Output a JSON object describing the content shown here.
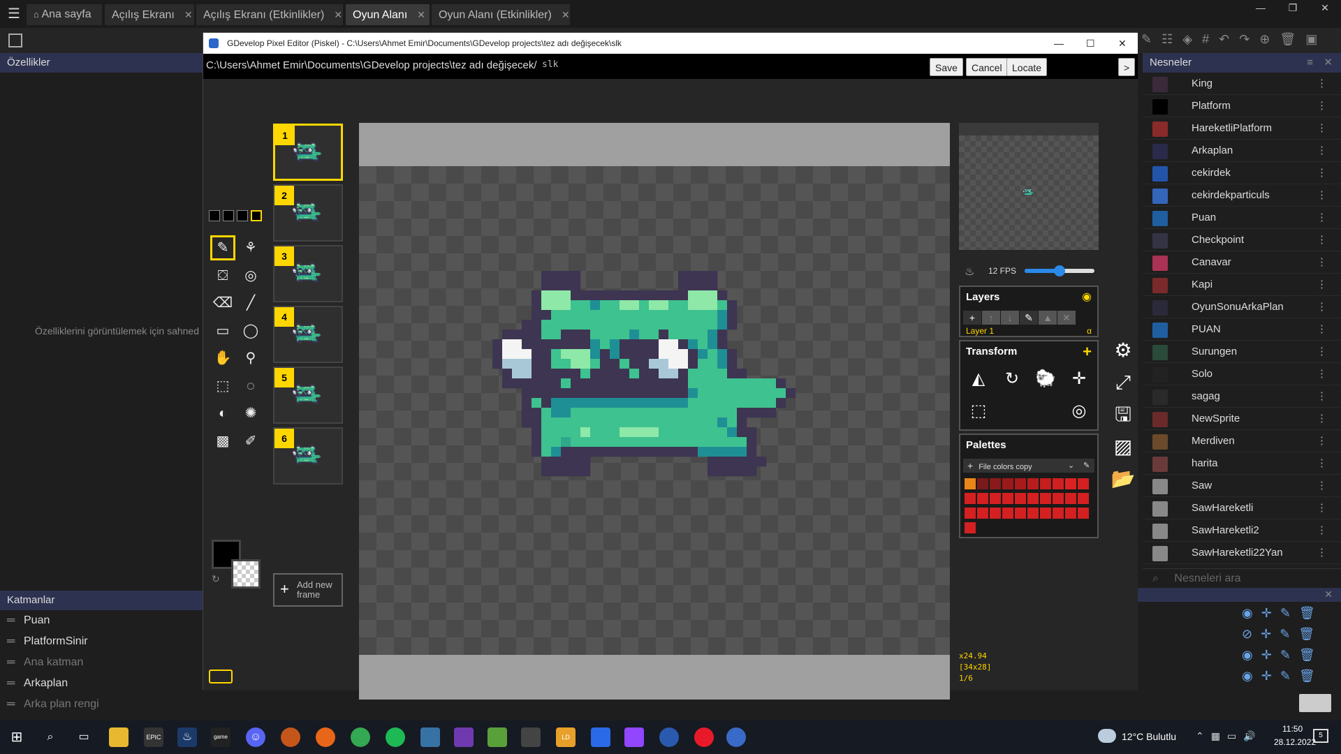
{
  "tabs": [
    {
      "label": "Ana sayfa",
      "active": false,
      "closable": false
    },
    {
      "label": "Açılış Ekranı",
      "active": false,
      "closable": true
    },
    {
      "label": "Açılış Ekranı (Etkinlikler)",
      "active": false,
      "closable": true
    },
    {
      "label": "Oyun Alanı",
      "active": true,
      "closable": true
    },
    {
      "label": "Oyun Alanı (Etkinlikler)",
      "active": false,
      "closable": true
    }
  ],
  "left_panel": {
    "title": "Özellikler",
    "empty_text": "Özelliklerini görüntülemek için sahned",
    "layers_title": "Katmanlar",
    "layers": [
      {
        "name": "Puan",
        "dim": false
      },
      {
        "name": "PlatformSinir",
        "dim": false
      },
      {
        "name": "Ana katman",
        "dim": true
      },
      {
        "name": "Arkaplan",
        "dim": false
      },
      {
        "name": "Arka plan rengi",
        "dim": true
      }
    ]
  },
  "right_panel": {
    "title": "Nesneler",
    "search_placeholder": "Nesneleri ara",
    "objects": [
      {
        "name": "King",
        "color": "#3a2a3a"
      },
      {
        "name": "Platform",
        "color": "#000000"
      },
      {
        "name": "HareketliPlatform",
        "color": "#8a2a2a"
      },
      {
        "name": "Arkaplan",
        "color": "#2a2a4a"
      },
      {
        "name": "cekirdek",
        "color": "#2255aa"
      },
      {
        "name": "cekirdekparticuls",
        "color": "#3366bb"
      },
      {
        "name": "Puan",
        "color": "#1f5f9f"
      },
      {
        "name": "Checkpoint",
        "color": "#333344"
      },
      {
        "name": "Canavar",
        "color": "#aa3355"
      },
      {
        "name": "Kapi",
        "color": "#7a2a2a"
      },
      {
        "name": "OyunSonuArkaPlan",
        "color": "#2a2a3a"
      },
      {
        "name": "PUAN",
        "color": "#1f5f9f"
      },
      {
        "name": "Surungen",
        "color": "#2a4a3a"
      },
      {
        "name": "Solo",
        "color": "#222222"
      },
      {
        "name": "sagag",
        "color": "#2a2a2a"
      },
      {
        "name": "NewSprite",
        "color": "#6a2a2a"
      },
      {
        "name": "Merdiven",
        "color": "#6a4a2a"
      },
      {
        "name": "harita",
        "color": "#6a3a3a"
      },
      {
        "name": "Saw",
        "color": "#888888"
      },
      {
        "name": "SawHareketli",
        "color": "#888888"
      },
      {
        "name": "SawHareketli2",
        "color": "#888888"
      },
      {
        "name": "SawHareketli22Yan",
        "color": "#888888"
      }
    ]
  },
  "piskel": {
    "window_title": "GDevelop Pixel Editor (Piskel) - C:\\Users\\Ahmet Emir\\Documents\\GDevelop projects\\tez adı değişecek\\slk",
    "path": "C:\\Users\\Ahmet Emir\\Documents\\GDevelop projects\\tez adı değişecek/",
    "file_name": "slk",
    "buttons": {
      "save": "Save",
      "cancel": "Cancel",
      "locate": "Locate",
      "more": ">"
    },
    "frames": [
      "1",
      "2",
      "3",
      "4",
      "5",
      "6"
    ],
    "add_frame_label": "Add new frame",
    "fps_label": "12 FPS",
    "fps_value": 12,
    "layers_title": "Layers",
    "layer_name": "Layer 1",
    "layer_alpha": "α",
    "transform_title": "Transform",
    "palettes_title": "Palettes",
    "palette_name": "File colors copy",
    "zoom": "x24.94",
    "size": "[34x28]",
    "frame_index": "1/6"
  },
  "taskbar": {
    "weather": "12°C Bulutlu",
    "time": "11:50",
    "date": "28.12.2022",
    "notifications": "5"
  },
  "colors": {
    "accent": "#ffd700",
    "panel_header": "#2d3250",
    "sprite_dark": "#3d3552",
    "sprite_green": "#3ec28f",
    "sprite_light": "#8ee8a8",
    "sprite_teal": "#1f8f96"
  }
}
